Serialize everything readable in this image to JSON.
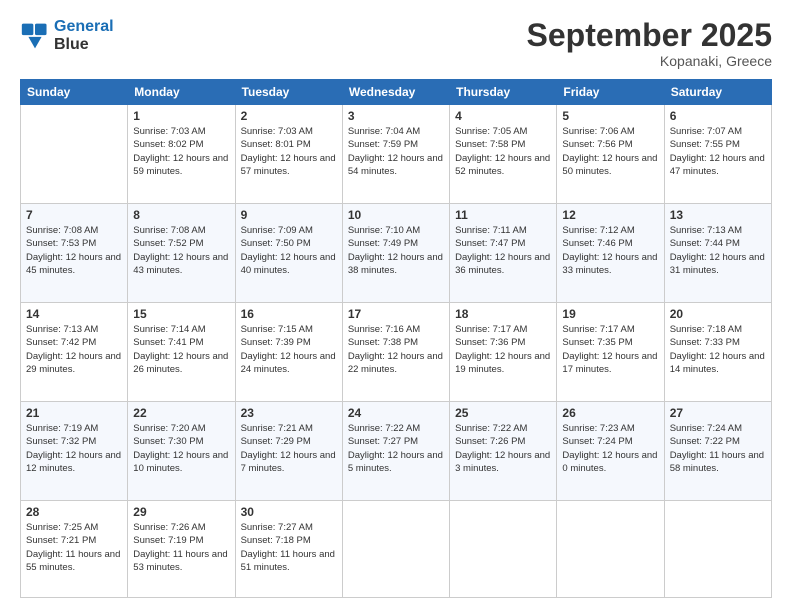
{
  "header": {
    "logo_line1": "General",
    "logo_line2": "Blue",
    "month": "September 2025",
    "location": "Kopanaki, Greece"
  },
  "weekdays": [
    "Sunday",
    "Monday",
    "Tuesday",
    "Wednesday",
    "Thursday",
    "Friday",
    "Saturday"
  ],
  "weeks": [
    [
      {
        "day": "",
        "empty": true
      },
      {
        "day": "1",
        "sunrise": "7:03 AM",
        "sunset": "8:02 PM",
        "daylight": "12 hours and 59 minutes."
      },
      {
        "day": "2",
        "sunrise": "7:03 AM",
        "sunset": "8:01 PM",
        "daylight": "12 hours and 57 minutes."
      },
      {
        "day": "3",
        "sunrise": "7:04 AM",
        "sunset": "7:59 PM",
        "daylight": "12 hours and 54 minutes."
      },
      {
        "day": "4",
        "sunrise": "7:05 AM",
        "sunset": "7:58 PM",
        "daylight": "12 hours and 52 minutes."
      },
      {
        "day": "5",
        "sunrise": "7:06 AM",
        "sunset": "7:56 PM",
        "daylight": "12 hours and 50 minutes."
      },
      {
        "day": "6",
        "sunrise": "7:07 AM",
        "sunset": "7:55 PM",
        "daylight": "12 hours and 47 minutes."
      }
    ],
    [
      {
        "day": "7",
        "sunrise": "7:08 AM",
        "sunset": "7:53 PM",
        "daylight": "12 hours and 45 minutes."
      },
      {
        "day": "8",
        "sunrise": "7:08 AM",
        "sunset": "7:52 PM",
        "daylight": "12 hours and 43 minutes."
      },
      {
        "day": "9",
        "sunrise": "7:09 AM",
        "sunset": "7:50 PM",
        "daylight": "12 hours and 40 minutes."
      },
      {
        "day": "10",
        "sunrise": "7:10 AM",
        "sunset": "7:49 PM",
        "daylight": "12 hours and 38 minutes."
      },
      {
        "day": "11",
        "sunrise": "7:11 AM",
        "sunset": "7:47 PM",
        "daylight": "12 hours and 36 minutes."
      },
      {
        "day": "12",
        "sunrise": "7:12 AM",
        "sunset": "7:46 PM",
        "daylight": "12 hours and 33 minutes."
      },
      {
        "day": "13",
        "sunrise": "7:13 AM",
        "sunset": "7:44 PM",
        "daylight": "12 hours and 31 minutes."
      }
    ],
    [
      {
        "day": "14",
        "sunrise": "7:13 AM",
        "sunset": "7:42 PM",
        "daylight": "12 hours and 29 minutes."
      },
      {
        "day": "15",
        "sunrise": "7:14 AM",
        "sunset": "7:41 PM",
        "daylight": "12 hours and 26 minutes."
      },
      {
        "day": "16",
        "sunrise": "7:15 AM",
        "sunset": "7:39 PM",
        "daylight": "12 hours and 24 minutes."
      },
      {
        "day": "17",
        "sunrise": "7:16 AM",
        "sunset": "7:38 PM",
        "daylight": "12 hours and 22 minutes."
      },
      {
        "day": "18",
        "sunrise": "7:17 AM",
        "sunset": "7:36 PM",
        "daylight": "12 hours and 19 minutes."
      },
      {
        "day": "19",
        "sunrise": "7:17 AM",
        "sunset": "7:35 PM",
        "daylight": "12 hours and 17 minutes."
      },
      {
        "day": "20",
        "sunrise": "7:18 AM",
        "sunset": "7:33 PM",
        "daylight": "12 hours and 14 minutes."
      }
    ],
    [
      {
        "day": "21",
        "sunrise": "7:19 AM",
        "sunset": "7:32 PM",
        "daylight": "12 hours and 12 minutes."
      },
      {
        "day": "22",
        "sunrise": "7:20 AM",
        "sunset": "7:30 PM",
        "daylight": "12 hours and 10 minutes."
      },
      {
        "day": "23",
        "sunrise": "7:21 AM",
        "sunset": "7:29 PM",
        "daylight": "12 hours and 7 minutes."
      },
      {
        "day": "24",
        "sunrise": "7:22 AM",
        "sunset": "7:27 PM",
        "daylight": "12 hours and 5 minutes."
      },
      {
        "day": "25",
        "sunrise": "7:22 AM",
        "sunset": "7:26 PM",
        "daylight": "12 hours and 3 minutes."
      },
      {
        "day": "26",
        "sunrise": "7:23 AM",
        "sunset": "7:24 PM",
        "daylight": "12 hours and 0 minutes."
      },
      {
        "day": "27",
        "sunrise": "7:24 AM",
        "sunset": "7:22 PM",
        "daylight": "11 hours and 58 minutes."
      }
    ],
    [
      {
        "day": "28",
        "sunrise": "7:25 AM",
        "sunset": "7:21 PM",
        "daylight": "11 hours and 55 minutes."
      },
      {
        "day": "29",
        "sunrise": "7:26 AM",
        "sunset": "7:19 PM",
        "daylight": "11 hours and 53 minutes."
      },
      {
        "day": "30",
        "sunrise": "7:27 AM",
        "sunset": "7:18 PM",
        "daylight": "11 hours and 51 minutes."
      },
      {
        "day": "",
        "empty": true
      },
      {
        "day": "",
        "empty": true
      },
      {
        "day": "",
        "empty": true
      },
      {
        "day": "",
        "empty": true
      }
    ]
  ]
}
